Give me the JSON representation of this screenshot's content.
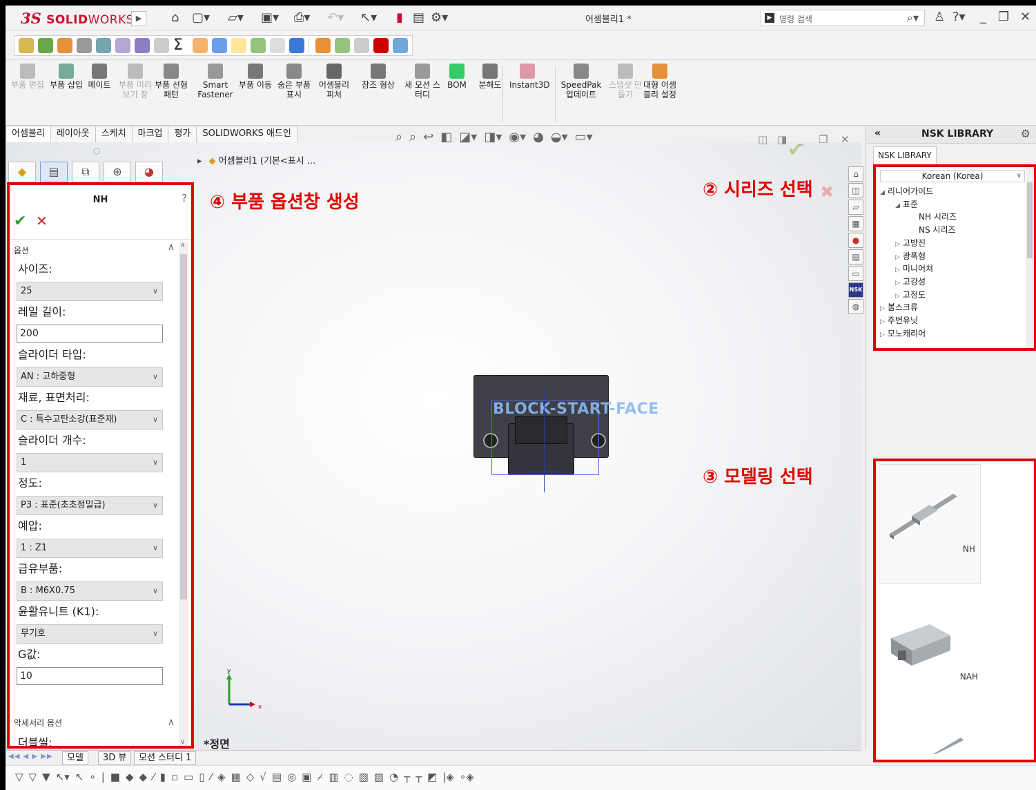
{
  "app": {
    "logo_ds": "3S",
    "logo_solid": "SOLID",
    "logo_works": "WORKS",
    "doc_title": "어셈블리1 *",
    "search_placeholder": "명령 검색"
  },
  "command_manager": [
    {
      "label": "부품 편집",
      "disabled": true
    },
    {
      "label": "부품 삽입",
      "disabled": false
    },
    {
      "label": "메이트",
      "disabled": false
    },
    {
      "label": "부품 미리보기 창",
      "disabled": true
    },
    {
      "label": "부품 선형 패턴",
      "disabled": false
    },
    {
      "label": "Smart Fastener",
      "disabled": false
    },
    {
      "label": "부품 이동",
      "disabled": false
    },
    {
      "label": "숨은 부품 표시",
      "disabled": false
    },
    {
      "label": "어셈블리 피처",
      "disabled": false
    },
    {
      "label": "참조 형상",
      "disabled": false
    },
    {
      "label": "새 모션 스터디",
      "disabled": false
    },
    {
      "label": "BOM",
      "disabled": false
    },
    {
      "label": "분해도",
      "disabled": false
    },
    {
      "label": "Instant3D",
      "disabled": false
    },
    {
      "label": "SpeedPak 업데이트",
      "disabled": false
    },
    {
      "label": "스냅샷 만들기",
      "disabled": true
    },
    {
      "label": "대형 어셈블리 설정",
      "disabled": false
    }
  ],
  "tabs": [
    "어셈블리",
    "레이아웃",
    "스케치",
    "마크업",
    "평가",
    "SOLIDWORKS 애드인"
  ],
  "breadcrumb": "어셈블리1 (기본<표시 ...",
  "property_manager": {
    "title": "NH",
    "section_options": "옵션",
    "fields": [
      {
        "label": "사이즈:",
        "type": "select",
        "value": "25"
      },
      {
        "label": "레일 길이:",
        "type": "input",
        "value": "200"
      },
      {
        "label": "슬라이더 타입:",
        "type": "select",
        "value": "AN : 고하중형"
      },
      {
        "label": "재료, 표면처리:",
        "type": "select",
        "value": "C : 특수고탄소강(표준재)"
      },
      {
        "label": "슬라이더 개수:",
        "type": "select",
        "value": "1"
      },
      {
        "label": "정도:",
        "type": "select",
        "value": "P3 : 표준(초초정밀급)"
      },
      {
        "label": "예압:",
        "type": "select",
        "value": "1 : Z1"
      },
      {
        "label": "급유부품:",
        "type": "select",
        "value": "B : M6X0.75"
      },
      {
        "label": "윤활유니트 (K1):",
        "type": "select",
        "value": "무기호"
      },
      {
        "label": "G값:",
        "type": "input",
        "value": "10"
      }
    ],
    "section_accessory": "악세서리 옵션",
    "accessory_label": "더블씰:"
  },
  "annotations": {
    "pm": "④ 부품 옵션창 생성",
    "series": "② 시리즈 선택",
    "model": "③ 모델링 선택"
  },
  "graphics": {
    "block_label": "BLOCK-START-FACE",
    "view_label": "*정면",
    "triad_x": "x",
    "triad_y": "y"
  },
  "nsk": {
    "title": "NSK LIBRARY",
    "tab": "NSK LIBRARY",
    "language": "Korean (Korea)",
    "tree": [
      {
        "label": "리니어가이드",
        "depth": 0,
        "arrow": "◢"
      },
      {
        "label": "표준",
        "depth": 1,
        "arrow": "◢"
      },
      {
        "label": "NH 시리즈",
        "depth": 2,
        "arrow": ""
      },
      {
        "label": "NS 시리즈",
        "depth": 2,
        "arrow": ""
      },
      {
        "label": "고방진",
        "depth": 1,
        "arrow": "▷"
      },
      {
        "label": "광폭형",
        "depth": 1,
        "arrow": "▷"
      },
      {
        "label": "미니어쳐",
        "depth": 1,
        "arrow": "▷"
      },
      {
        "label": "고강성",
        "depth": 1,
        "arrow": "▷"
      },
      {
        "label": "고정도",
        "depth": 1,
        "arrow": "▷"
      },
      {
        "label": "볼스크류",
        "depth": 0,
        "arrow": "▷"
      },
      {
        "label": "주변유닛",
        "depth": 0,
        "arrow": "▷"
      },
      {
        "label": "모노캐리어",
        "depth": 0,
        "arrow": "▷"
      }
    ],
    "gallery": [
      "NH",
      "NAH"
    ]
  },
  "bottom_tabs": [
    "모델",
    "3D 뷰",
    "모션 스터디 1"
  ]
}
